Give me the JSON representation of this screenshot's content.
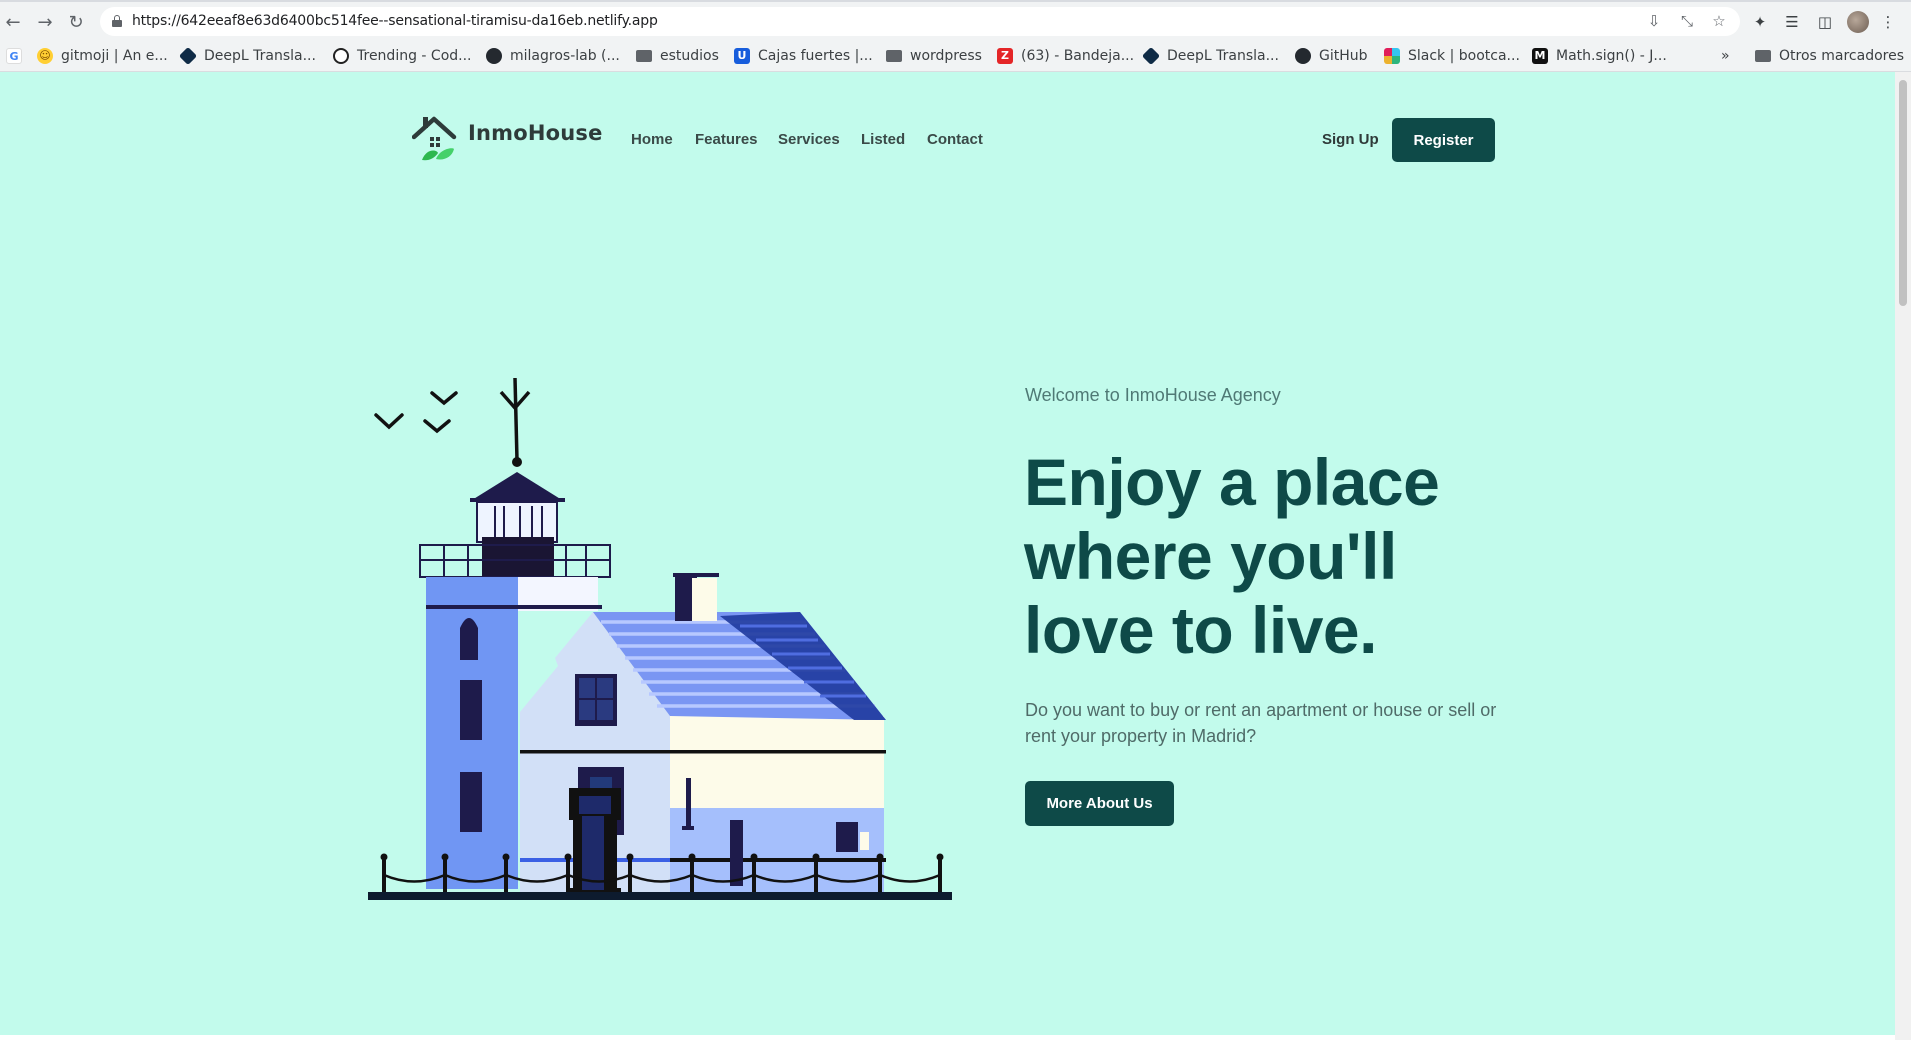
{
  "browser": {
    "url": "https://642eeaf8e63d6400bc514fee--sensational-tiramisu-da16eb.netlify.app",
    "icons": {
      "back": "arrow-left-icon",
      "forward": "arrow-right-icon",
      "reload": "reload-icon",
      "lock": "lock-icon",
      "install": "install-app-icon",
      "share": "share-icon",
      "bookmark": "star-icon",
      "extensions": "puzzle-icon",
      "reading_list": "reading-list-icon",
      "side_panel": "side-panel-icon",
      "menu": "kebab-menu-icon"
    }
  },
  "bookmarks": {
    "items": [
      {
        "label": "gitmoji | An e...",
        "icon": "gitmoji-favicon"
      },
      {
        "label": "DeepL Transla...",
        "icon": "deepl-favicon"
      },
      {
        "label": "Trending - Cod...",
        "icon": "codepen-favicon"
      },
      {
        "label": "milagros-lab (...",
        "icon": "github-favicon"
      },
      {
        "label": "estudios",
        "icon": "folder-icon"
      },
      {
        "label": "Cajas fuertes |...",
        "icon": "bitwarden-favicon"
      },
      {
        "label": "wordpress",
        "icon": "folder-icon"
      },
      {
        "label": "(63) - Bandeja...",
        "icon": "zoho-favicon"
      },
      {
        "label": "DeepL Transla...",
        "icon": "deepl-favicon"
      },
      {
        "label": "GitHub",
        "icon": "github-favicon"
      },
      {
        "label": "Slack | bootca...",
        "icon": "slack-favicon"
      },
      {
        "label": "Math.sign() - J...",
        "icon": "mdn-favicon"
      }
    ],
    "overflow": "»",
    "other": "Otros marcadores"
  },
  "site": {
    "brand": "InmoHouse",
    "nav": {
      "home": "Home",
      "features": "Features",
      "services": "Services",
      "listed": "Listed",
      "contact": "Contact"
    },
    "sign_up": "Sign Up",
    "register": "Register",
    "hero": {
      "eyebrow": "Welcome to InmoHouse Agency",
      "headline": "Enjoy a place where you'll love to live.",
      "lead": "Do you want to buy or rent an apartment or house or sell or rent your property in Madrid?",
      "cta": "More About Us"
    }
  },
  "colors": {
    "page_bg": "#c2fbec",
    "brand_dark": "#0e4a48",
    "house_blue": "#7096f3",
    "leaf_green": "#34c759"
  }
}
